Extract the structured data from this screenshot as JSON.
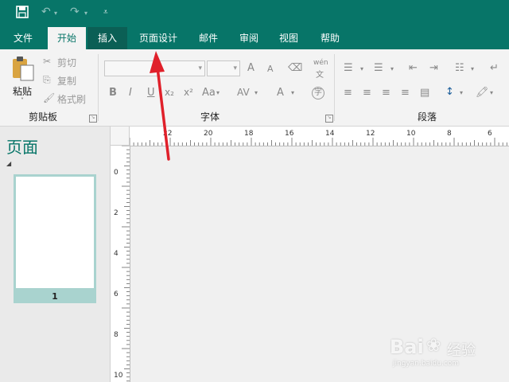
{
  "menu": {
    "file": "文件",
    "home": "开始",
    "insert": "插入",
    "page_design": "页面设计",
    "mailings": "邮件",
    "review": "审阅",
    "view": "视图",
    "help": "帮助"
  },
  "clipboard": {
    "paste": "粘贴",
    "cut": "剪切",
    "copy": "复制",
    "format_painter": "格式刷",
    "group": "剪贴板"
  },
  "font": {
    "group": "字体",
    "bold": "B",
    "italic": "I",
    "underline": "U",
    "subscript": "x₂",
    "superscript": "x²",
    "change_case": "Aa",
    "spacing": "AV",
    "font_color": "A",
    "grow": "A",
    "shrink": "A",
    "pinyin_top": "wén",
    "pinyin_bottom": "文",
    "enclose": "字"
  },
  "paragraph": {
    "group": "段落"
  },
  "pages_pane": {
    "title": "页面",
    "page_number": "1"
  },
  "ruler": {
    "h_labels": [
      "22",
      "20",
      "18",
      "16",
      "14",
      "12",
      "10",
      "8",
      "6"
    ],
    "v_labels": [
      "0",
      "2",
      "4",
      "6",
      "8",
      "10"
    ]
  },
  "watermark": {
    "brand": "Bai",
    "brand_suffix": "经验",
    "url": "jingyan.baidu.com"
  },
  "colors": {
    "accent": "#077568",
    "annotation_arrow": "#e0202a"
  }
}
